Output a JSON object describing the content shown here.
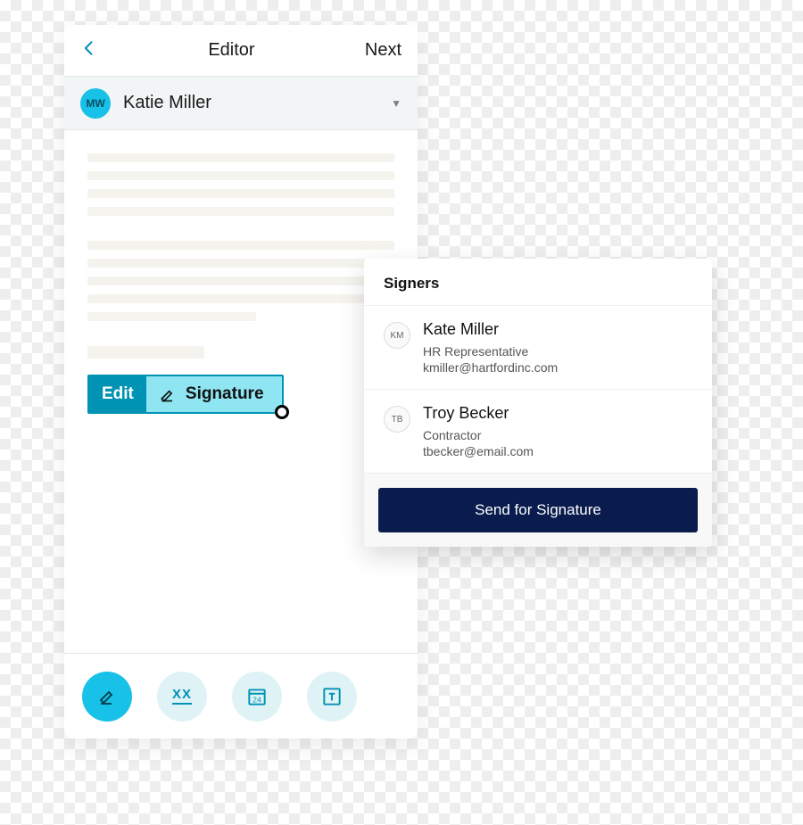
{
  "header": {
    "title": "Editor",
    "next": "Next"
  },
  "current_signer": {
    "initials": "MW",
    "name": "Katie Miller"
  },
  "sig_field": {
    "edit_label": "Edit",
    "type_label": "Signature"
  },
  "toolbar": {
    "initials": "XX",
    "date": "24"
  },
  "panel": {
    "title": "Signers",
    "signers": [
      {
        "initials": "KM",
        "name": "Kate Miller",
        "role": "HR Representative",
        "email": "kmiller@hartfordinc.com"
      },
      {
        "initials": "TB",
        "name": "Troy Becker",
        "role": "Contractor",
        "email": "tbecker@email.com"
      }
    ],
    "cta": "Send for Signature"
  }
}
